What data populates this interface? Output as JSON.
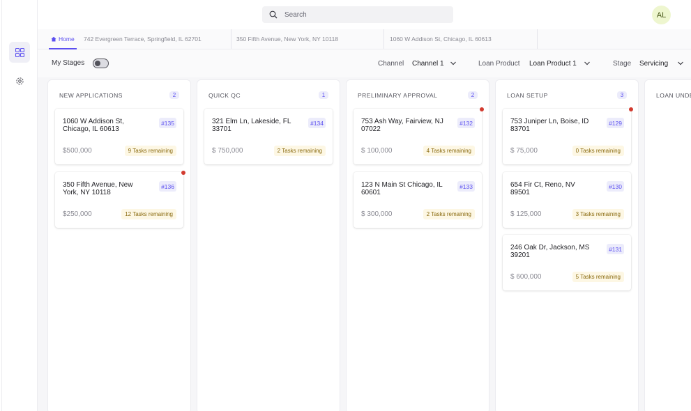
{
  "search": {
    "placeholder": "Search"
  },
  "user": {
    "initials": "AL"
  },
  "tabs": [
    {
      "label": "Home"
    },
    {
      "label": "742 Evergreen Terrace, Springfield, IL 62701"
    },
    {
      "label": "350 Fifth Avenue, New York, NY 10118"
    },
    {
      "label": "1060 W Addison St, Chicago, IL 60613"
    }
  ],
  "filters": {
    "my_stages": "My Stages",
    "channel_label": "Channel",
    "channel_value": "Channel 1",
    "loan_product_label": "Loan Product",
    "loan_product_value": "Loan Product 1",
    "stage_label": "Stage",
    "stage_value": "Servicing"
  },
  "columns": [
    {
      "title": "NEW APPLICATIONS",
      "count": "2",
      "cards": [
        {
          "address": "1060 W Addison St, Chicago, IL 60613",
          "id": "#135",
          "amount": "$500,000",
          "tasks": "9 Tasks remaining",
          "alert": false
        },
        {
          "address": "350 Fifth Avenue, New York, NY 10118",
          "id": "#136",
          "amount": "$250,000",
          "tasks": "12 Tasks remaining",
          "alert": true
        }
      ]
    },
    {
      "title": "QUICK QC",
      "count": "1",
      "cards": [
        {
          "address": "321 Elm Ln, Lakeside, FL 33701",
          "id": "#134",
          "amount": "$ 750,000",
          "tasks": "2 Tasks remaining",
          "alert": false
        }
      ]
    },
    {
      "title": "PRELIMINARY APPROVAL",
      "count": "2",
      "cards": [
        {
          "address": "753 Ash Way, Fairview, NJ 07022",
          "id": "#132",
          "amount": "$ 100,000",
          "tasks": "4 Tasks remaining",
          "alert": true
        },
        {
          "address": "123 N Main St Chicago, IL 60601",
          "id": "#133",
          "amount": "$ 300,000",
          "tasks": "2 Tasks remaining",
          "alert": false
        }
      ]
    },
    {
      "title": "LOAN SETUP",
      "count": "3",
      "cards": [
        {
          "address": "753 Juniper Ln, Boise, ID 83701",
          "id": "#129",
          "amount": "$ 75,000",
          "tasks": "0 Tasks remaining",
          "alert": true
        },
        {
          "address": "654 Fir Ct, Reno, NV 89501",
          "id": "#130",
          "amount": "$ 125,000",
          "tasks": "3 Tasks remaining",
          "alert": false
        },
        {
          "address": "246 Oak Dr, Jackson, MS 39201",
          "id": "#131",
          "amount": "$ 600,000",
          "tasks": "5 Tasks remaining",
          "alert": false
        }
      ]
    },
    {
      "title": "LOAN UNDE",
      "count": "",
      "cards": []
    }
  ],
  "colors": {
    "accent": "#5b4ff0",
    "alert_dot": "#d23a2f",
    "tasks_bg": "#fdf7e4"
  },
  "icons": {
    "rail": [
      "grid-icon",
      "settings-icon"
    ],
    "search": "search-icon",
    "tab_home": "home-icon",
    "dropdown": "chevron-down-icon"
  }
}
